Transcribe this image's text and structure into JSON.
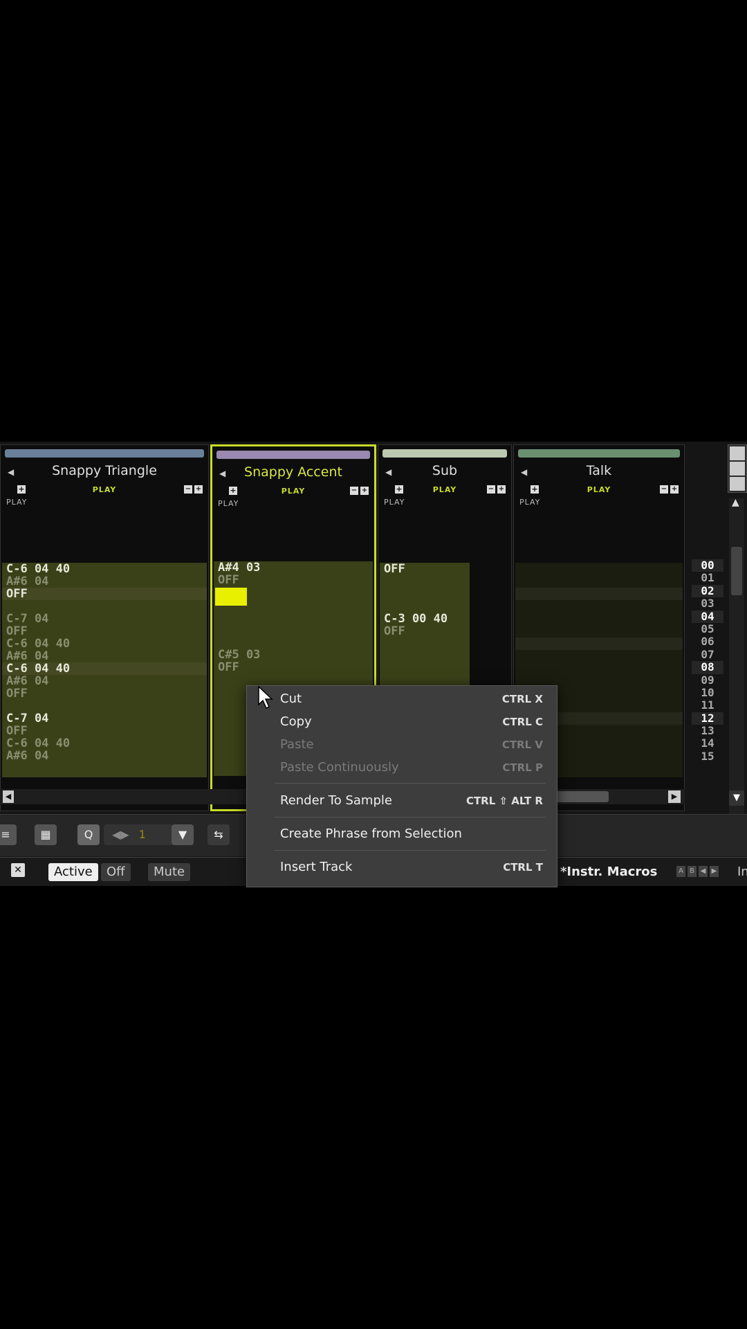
{
  "tracks": [
    {
      "name": "Snappy Triangle",
      "color": "#6a7f9a",
      "play_label": "PLAY",
      "play_small": "PLAY"
    },
    {
      "name": "Snappy Accent",
      "color": "#9a88b0",
      "play_label": "PLAY",
      "play_small": "PLAY"
    },
    {
      "name": "Sub",
      "color": "#bcc8b0",
      "play_label": "PLAY",
      "play_small": "PLAY"
    },
    {
      "name": "Talk",
      "color": "#6a9070",
      "play_label": "PLAY",
      "play_small": "PLAY"
    }
  ],
  "pattern_rows": {
    "track0": [
      "C-6 04 40",
      "A#6 04",
      "OFF",
      "",
      "C-7 04",
      "OFF",
      "C-6 04 40",
      "A#6 04",
      "C-6 04 40",
      "A#6 04",
      "OFF",
      "",
      "C-7 04",
      "OFF",
      "C-6 04 40",
      "A#6 04"
    ],
    "track1": [
      "A#4 03",
      "OFF",
      "",
      "",
      "",
      "",
      "",
      "C#5 03",
      "OFF",
      "",
      "",
      "",
      "",
      "",
      "",
      ""
    ],
    "track2": [
      "OFF",
      "",
      "",
      "",
      "C-3 00 40",
      "OFF",
      "",
      "",
      "",
      "",
      "",
      "",
      "",
      "",
      "",
      ""
    ]
  },
  "line_numbers": [
    "00",
    "01",
    "02",
    "03",
    "04",
    "05",
    "06",
    "07",
    "08",
    "09",
    "10",
    "11",
    "12",
    "13",
    "14",
    "15"
  ],
  "toolbar": {
    "q_label": "Q",
    "field_value": "1"
  },
  "status": {
    "active": "Active",
    "off": "Off",
    "mute": "Mute",
    "macros": "*Instr. Macros",
    "macros_trail": "In"
  },
  "context_menu": {
    "items": [
      {
        "label": "Cut",
        "shortcut": "CTRL X",
        "enabled": true
      },
      {
        "label": "Copy",
        "shortcut": "CTRL C",
        "enabled": true
      },
      {
        "label": "Paste",
        "shortcut": "CTRL V",
        "enabled": false
      },
      {
        "label": "Paste Continuously",
        "shortcut": "CTRL P",
        "enabled": false
      },
      {
        "label": "Render To Sample",
        "shortcut": "CTRL ⇧ ALT R",
        "enabled": true
      },
      {
        "label": "Create Phrase from Selection",
        "shortcut": "",
        "enabled": true
      },
      {
        "label": "Insert Track",
        "shortcut": "CTRL T",
        "enabled": true
      }
    ]
  },
  "colors": {
    "accent": "#c8dc28",
    "cursor": "#e8f000",
    "pattern_bg": "#3a4018"
  }
}
